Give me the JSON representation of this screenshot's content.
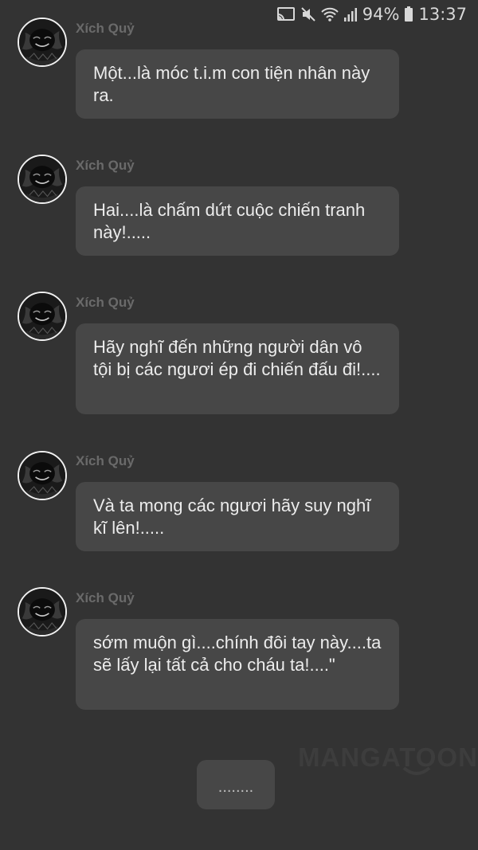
{
  "status_bar": {
    "battery": "94%",
    "time": "13:37",
    "icons": [
      "cast-icon",
      "mute-icon",
      "wifi-icon",
      "signal-icon",
      "battery-icon"
    ]
  },
  "messages": [
    {
      "sender": "Xích Quỷ",
      "avatar": "avatar-icon",
      "text": "Một...là móc t.i.m con tiện nhân này ra."
    },
    {
      "sender": "Xích Quỷ",
      "avatar": "avatar-icon",
      "text": "Hai....là chấm dứt cuộc chiến tranh này!....."
    },
    {
      "sender": "Xích Quỷ",
      "avatar": "avatar-icon",
      "text": "Hãy nghĩ đến những người dân vô tội bị các ngươi ép đi chiến đấu đi!...."
    },
    {
      "sender": "Xích Quỷ",
      "avatar": "avatar-icon",
      "text": "Và ta mong các ngươi hãy suy nghĩ kĩ lên!....."
    },
    {
      "sender": "Xích Quỷ",
      "avatar": "avatar-icon",
      "text": "sớm muộn gì....chính đôi tay này....ta sẽ lấy lại tất cả cho cháu ta!....\""
    }
  ],
  "watermark": "MANGATOON",
  "more_button": "........",
  "colors": {
    "background": "#333333",
    "bubble": "#474747",
    "sender_name": "#6a6a6a",
    "text": "#ececec"
  }
}
